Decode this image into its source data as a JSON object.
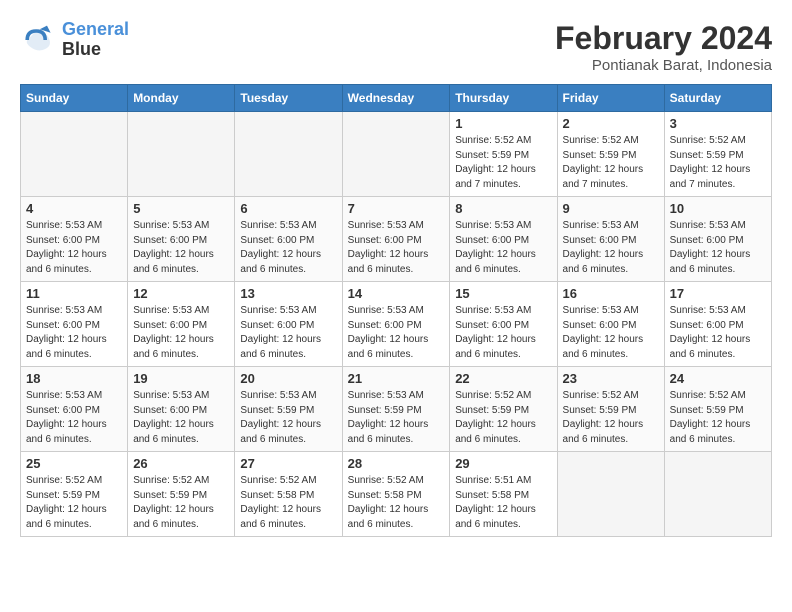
{
  "logo": {
    "line1": "General",
    "line2": "Blue"
  },
  "title": "February 2024",
  "location": "Pontianak Barat, Indonesia",
  "weekdays": [
    "Sunday",
    "Monday",
    "Tuesday",
    "Wednesday",
    "Thursday",
    "Friday",
    "Saturday"
  ],
  "weeks": [
    [
      {
        "num": "",
        "empty": true
      },
      {
        "num": "",
        "empty": true
      },
      {
        "num": "",
        "empty": true
      },
      {
        "num": "",
        "empty": true
      },
      {
        "num": "1",
        "sunrise": "5:52 AM",
        "sunset": "5:59 PM",
        "daylight": "12 hours and 7 minutes."
      },
      {
        "num": "2",
        "sunrise": "5:52 AM",
        "sunset": "5:59 PM",
        "daylight": "12 hours and 7 minutes."
      },
      {
        "num": "3",
        "sunrise": "5:52 AM",
        "sunset": "5:59 PM",
        "daylight": "12 hours and 7 minutes."
      }
    ],
    [
      {
        "num": "4",
        "sunrise": "5:53 AM",
        "sunset": "6:00 PM",
        "daylight": "12 hours and 6 minutes."
      },
      {
        "num": "5",
        "sunrise": "5:53 AM",
        "sunset": "6:00 PM",
        "daylight": "12 hours and 6 minutes."
      },
      {
        "num": "6",
        "sunrise": "5:53 AM",
        "sunset": "6:00 PM",
        "daylight": "12 hours and 6 minutes."
      },
      {
        "num": "7",
        "sunrise": "5:53 AM",
        "sunset": "6:00 PM",
        "daylight": "12 hours and 6 minutes."
      },
      {
        "num": "8",
        "sunrise": "5:53 AM",
        "sunset": "6:00 PM",
        "daylight": "12 hours and 6 minutes."
      },
      {
        "num": "9",
        "sunrise": "5:53 AM",
        "sunset": "6:00 PM",
        "daylight": "12 hours and 6 minutes."
      },
      {
        "num": "10",
        "sunrise": "5:53 AM",
        "sunset": "6:00 PM",
        "daylight": "12 hours and 6 minutes."
      }
    ],
    [
      {
        "num": "11",
        "sunrise": "5:53 AM",
        "sunset": "6:00 PM",
        "daylight": "12 hours and 6 minutes."
      },
      {
        "num": "12",
        "sunrise": "5:53 AM",
        "sunset": "6:00 PM",
        "daylight": "12 hours and 6 minutes."
      },
      {
        "num": "13",
        "sunrise": "5:53 AM",
        "sunset": "6:00 PM",
        "daylight": "12 hours and 6 minutes."
      },
      {
        "num": "14",
        "sunrise": "5:53 AM",
        "sunset": "6:00 PM",
        "daylight": "12 hours and 6 minutes."
      },
      {
        "num": "15",
        "sunrise": "5:53 AM",
        "sunset": "6:00 PM",
        "daylight": "12 hours and 6 minutes."
      },
      {
        "num": "16",
        "sunrise": "5:53 AM",
        "sunset": "6:00 PM",
        "daylight": "12 hours and 6 minutes."
      },
      {
        "num": "17",
        "sunrise": "5:53 AM",
        "sunset": "6:00 PM",
        "daylight": "12 hours and 6 minutes."
      }
    ],
    [
      {
        "num": "18",
        "sunrise": "5:53 AM",
        "sunset": "6:00 PM",
        "daylight": "12 hours and 6 minutes."
      },
      {
        "num": "19",
        "sunrise": "5:53 AM",
        "sunset": "6:00 PM",
        "daylight": "12 hours and 6 minutes."
      },
      {
        "num": "20",
        "sunrise": "5:53 AM",
        "sunset": "5:59 PM",
        "daylight": "12 hours and 6 minutes."
      },
      {
        "num": "21",
        "sunrise": "5:53 AM",
        "sunset": "5:59 PM",
        "daylight": "12 hours and 6 minutes."
      },
      {
        "num": "22",
        "sunrise": "5:52 AM",
        "sunset": "5:59 PM",
        "daylight": "12 hours and 6 minutes."
      },
      {
        "num": "23",
        "sunrise": "5:52 AM",
        "sunset": "5:59 PM",
        "daylight": "12 hours and 6 minutes."
      },
      {
        "num": "24",
        "sunrise": "5:52 AM",
        "sunset": "5:59 PM",
        "daylight": "12 hours and 6 minutes."
      }
    ],
    [
      {
        "num": "25",
        "sunrise": "5:52 AM",
        "sunset": "5:59 PM",
        "daylight": "12 hours and 6 minutes."
      },
      {
        "num": "26",
        "sunrise": "5:52 AM",
        "sunset": "5:59 PM",
        "daylight": "12 hours and 6 minutes."
      },
      {
        "num": "27",
        "sunrise": "5:52 AM",
        "sunset": "5:58 PM",
        "daylight": "12 hours and 6 minutes."
      },
      {
        "num": "28",
        "sunrise": "5:52 AM",
        "sunset": "5:58 PM",
        "daylight": "12 hours and 6 minutes."
      },
      {
        "num": "29",
        "sunrise": "5:51 AM",
        "sunset": "5:58 PM",
        "daylight": "12 hours and 6 minutes."
      },
      {
        "num": "",
        "empty": true
      },
      {
        "num": "",
        "empty": true
      }
    ]
  ]
}
